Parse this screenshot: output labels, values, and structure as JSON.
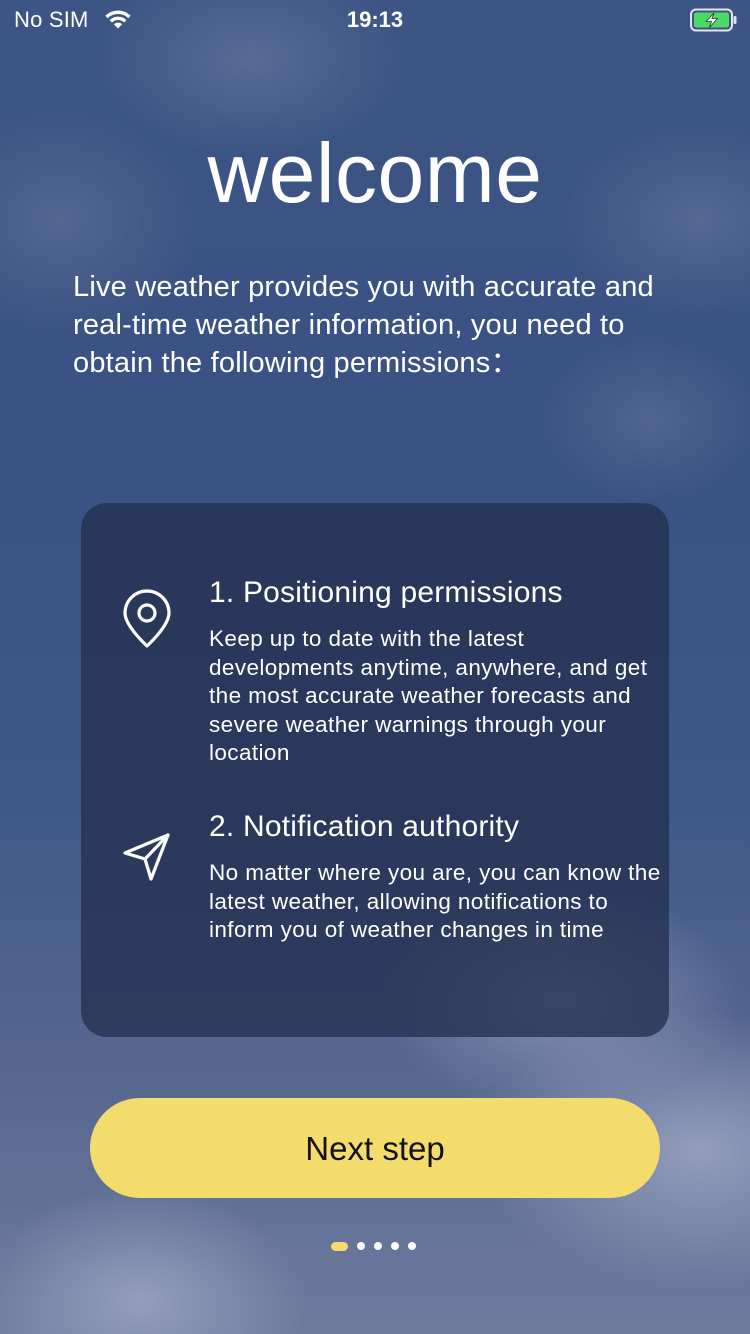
{
  "status_bar": {
    "carrier": "No SIM",
    "time": "19:13",
    "wifi_icon": "wifi-icon",
    "battery_icon": "battery-charging-icon",
    "battery_color": "#4cd964"
  },
  "welcome": {
    "title": "welcome",
    "intro": "Live weather provides you with accurate and real-time weather information, you need to obtain the following permissions："
  },
  "permissions": [
    {
      "icon": "location-pin-icon",
      "title": "1. Positioning permissions",
      "description": "Keep up to date with the latest developments anytime, anywhere, and get the most accurate weather forecasts and severe weather warnings through your location"
    },
    {
      "icon": "send-arrow-icon",
      "title": "2. Notification authority",
      "description": "No matter where you are, you can know the latest weather, allowing notifications to inform you of weather changes in time"
    }
  ],
  "next_button": {
    "label": "Next step",
    "color": "#f3dc6b"
  },
  "pagination": {
    "total": 5,
    "current": 1,
    "active_color": "#f3dc6b"
  }
}
